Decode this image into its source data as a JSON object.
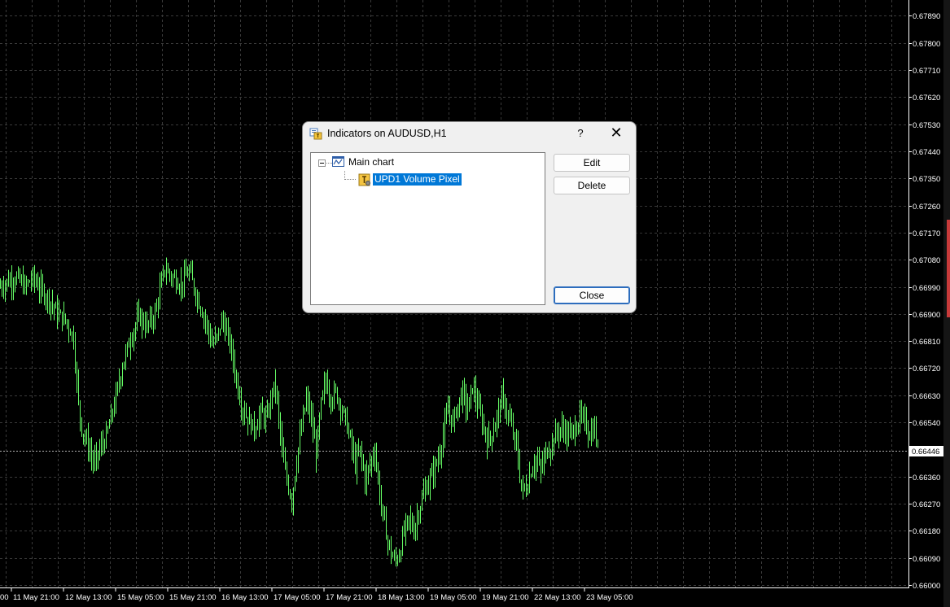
{
  "chart_data": {
    "type": "candlestick",
    "symbol": "AUDUSD",
    "timeframe": "H1",
    "grid": true,
    "colors": {
      "background": "#000000",
      "candle": "#66ff66",
      "grid": "#3a3a3a",
      "axis_text": "#ffffff",
      "bid_line": "#b0b0b0"
    },
    "ylim": [
      0.66,
      0.6791
    ],
    "price_ticks": [
      "0.67890",
      "0.67800",
      "0.67710",
      "0.67620",
      "0.67530",
      "0.67440",
      "0.67350",
      "0.67260",
      "0.67170",
      "0.67080",
      "0.66990",
      "0.66900",
      "0.66810",
      "0.66720",
      "0.66630",
      "0.66540",
      "0.66446",
      "0.66360",
      "0.66270",
      "0.66180",
      "0.66090",
      "0.66000"
    ],
    "price_tick_values": [
      0.6789,
      0.678,
      0.6771,
      0.6762,
      0.6753,
      0.6744,
      0.6735,
      0.6726,
      0.6717,
      0.6708,
      0.6699,
      0.669,
      0.6681,
      0.6672,
      0.6663,
      0.6654,
      0.66446,
      0.6636,
      0.6627,
      0.6618,
      0.6609,
      0.66
    ],
    "current_price": "0.66446",
    "time_labels": [
      "11 May 21:00",
      "12 May 13:00",
      "15 May 05:00",
      "15 May 21:00",
      "16 May 13:00",
      "17 May 05:00",
      "17 May 21:00",
      "18 May 13:00",
      "19 May 05:00",
      "19 May 21:00",
      "22 May 13:00",
      "23 May 05:00"
    ],
    "time_label_truncated_prefix": "00",
    "close_path": [
      [
        0,
        0.6699
      ],
      [
        10,
        0.6701
      ],
      [
        20,
        0.6702
      ],
      [
        30,
        0.6699
      ],
      [
        40,
        0.6702
      ],
      [
        50,
        0.6698
      ],
      [
        60,
        0.6695
      ],
      [
        70,
        0.669
      ],
      [
        80,
        0.6688
      ],
      [
        90,
        0.6682
      ],
      [
        96,
        0.666
      ],
      [
        100,
        0.6652
      ],
      [
        108,
        0.6646
      ],
      [
        115,
        0.664
      ],
      [
        122,
        0.6645
      ],
      [
        130,
        0.6649
      ],
      [
        140,
        0.666
      ],
      [
        150,
        0.6673
      ],
      [
        160,
        0.6682
      ],
      [
        170,
        0.6689
      ],
      [
        180,
        0.6686
      ],
      [
        190,
        0.669
      ],
      [
        196,
        0.6698
      ],
      [
        202,
        0.6705
      ],
      [
        212,
        0.6702
      ],
      [
        222,
        0.67
      ],
      [
        232,
        0.6704
      ],
      [
        240,
        0.6697
      ],
      [
        245,
        0.6693
      ],
      [
        252,
        0.6688
      ],
      [
        260,
        0.668
      ],
      [
        266,
        0.6682
      ],
      [
        272,
        0.6688
      ],
      [
        278,
        0.6684
      ],
      [
        284,
        0.6678
      ],
      [
        290,
        0.6668
      ],
      [
        296,
        0.666
      ],
      [
        304,
        0.6655
      ],
      [
        312,
        0.6652
      ],
      [
        320,
        0.6657
      ],
      [
        328,
        0.6655
      ],
      [
        334,
        0.6665
      ],
      [
        338,
        0.6666
      ],
      [
        342,
        0.6655
      ],
      [
        348,
        0.664
      ],
      [
        352,
        0.6635
      ],
      [
        358,
        0.6628
      ],
      [
        364,
        0.6642
      ],
      [
        370,
        0.6652
      ],
      [
        376,
        0.6662
      ],
      [
        382,
        0.6655
      ],
      [
        388,
        0.6644
      ],
      [
        394,
        0.666
      ],
      [
        400,
        0.6668
      ],
      [
        406,
        0.6662
      ],
      [
        412,
        0.6664
      ],
      [
        418,
        0.666
      ],
      [
        424,
        0.6655
      ],
      [
        430,
        0.6648
      ],
      [
        436,
        0.664
      ],
      [
        442,
        0.6645
      ],
      [
        448,
        0.6635
      ],
      [
        454,
        0.664
      ],
      [
        460,
        0.6645
      ],
      [
        466,
        0.663
      ],
      [
        472,
        0.662
      ],
      [
        478,
        0.6612
      ],
      [
        484,
        0.6608
      ],
      [
        490,
        0.661
      ],
      [
        496,
        0.6618
      ],
      [
        502,
        0.6622
      ],
      [
        508,
        0.6618
      ],
      [
        514,
        0.6625
      ],
      [
        520,
        0.663
      ],
      [
        526,
        0.6634
      ],
      [
        532,
        0.6638
      ],
      [
        538,
        0.6642
      ],
      [
        544,
        0.665
      ],
      [
        550,
        0.6658
      ],
      [
        556,
        0.6654
      ],
      [
        562,
        0.666
      ],
      [
        568,
        0.6664
      ],
      [
        574,
        0.6658
      ],
      [
        580,
        0.6666
      ],
      [
        586,
        0.666
      ],
      [
        592,
        0.6654
      ],
      [
        598,
        0.6648
      ],
      [
        604,
        0.665
      ],
      [
        610,
        0.6656
      ],
      [
        616,
        0.6662
      ],
      [
        622,
        0.6658
      ],
      [
        628,
        0.6652
      ],
      [
        634,
        0.6646
      ],
      [
        640,
        0.6632
      ],
      [
        646,
        0.6632
      ],
      [
        652,
        0.6638
      ],
      [
        658,
        0.6642
      ],
      [
        664,
        0.6638
      ],
      [
        670,
        0.6644
      ],
      [
        676,
        0.6646
      ],
      [
        682,
        0.665
      ],
      [
        688,
        0.6652
      ],
      [
        694,
        0.6651
      ],
      [
        700,
        0.665
      ],
      [
        706,
        0.6652
      ],
      [
        712,
        0.6656
      ],
      [
        718,
        0.6654
      ],
      [
        724,
        0.665
      ],
      [
        730,
        0.6652
      ],
      [
        734,
        0.6645
      ]
    ]
  },
  "dialog": {
    "title": "Indicators on AUDUSD,H1",
    "help_label": "?",
    "close_icon_glyph": "✕",
    "icons": {
      "title": "indicators-icon",
      "main_chart": "chart-window-icon",
      "indicator": "custom-indicator-icon"
    },
    "tree": {
      "main_chart_label": "Main chart",
      "indicator_label": "UPD1 Volume Pixel"
    },
    "buttons": {
      "edit": "Edit",
      "delete": "Delete",
      "close": "Close"
    }
  }
}
